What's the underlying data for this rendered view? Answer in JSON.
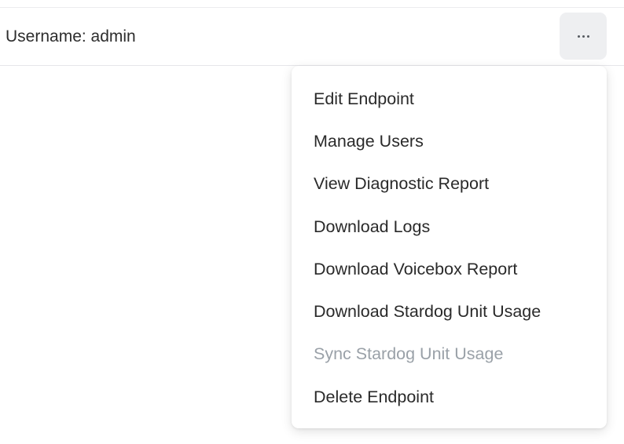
{
  "row": {
    "label": "Username: admin",
    "more_button_icon": "more-horizontal-icon"
  },
  "menu": {
    "items": [
      {
        "label": "Edit Endpoint",
        "disabled": false
      },
      {
        "label": "Manage Users",
        "disabled": false
      },
      {
        "label": "View Diagnostic Report",
        "disabled": false
      },
      {
        "label": "Download Logs",
        "disabled": false
      },
      {
        "label": "Download Voicebox Report",
        "disabled": false
      },
      {
        "label": "Download Stardog Unit Usage",
        "disabled": false
      },
      {
        "label": "Sync Stardog Unit Usage",
        "disabled": true
      },
      {
        "label": "Delete Endpoint",
        "disabled": false
      }
    ]
  },
  "colors": {
    "button_bg": "#eeeff1",
    "disabled_text": "#9aa1a8",
    "text": "#2a2a2a"
  }
}
